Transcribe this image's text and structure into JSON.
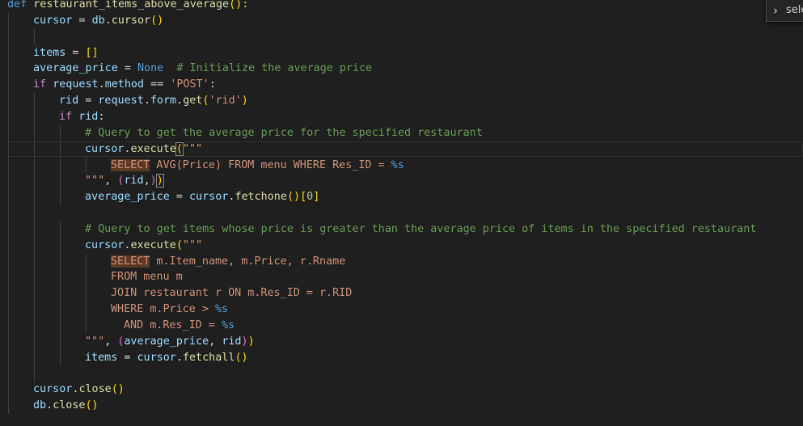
{
  "editor": {
    "lines": [
      {
        "indent": 0,
        "tokens": [
          [
            "def",
            "kw"
          ],
          [
            " ",
            ""
          ],
          [
            "restaurant_items_above_average",
            "fn"
          ],
          [
            "():",
            "p1"
          ]
        ]
      },
      {
        "indent": 2,
        "tokens": [
          [
            "cursor",
            "var"
          ],
          [
            " = ",
            "op"
          ],
          [
            "db",
            "var"
          ],
          [
            ".",
            ""
          ],
          [
            "cursor",
            "fn"
          ],
          [
            "()",
            "p1"
          ]
        ]
      },
      {
        "indent": 0,
        "tokens": []
      },
      {
        "indent": 2,
        "tokens": [
          [
            "items",
            "var"
          ],
          [
            " = ",
            "op"
          ],
          [
            "[]",
            "p1"
          ]
        ]
      },
      {
        "indent": 2,
        "tokens": [
          [
            "average_price",
            "var"
          ],
          [
            " = ",
            "op"
          ],
          [
            "None",
            "kw"
          ],
          [
            "  ",
            ""
          ],
          [
            "# Initialize the average price",
            "cmt"
          ]
        ]
      },
      {
        "indent": 2,
        "tokens": [
          [
            "if",
            "ctl"
          ],
          [
            " ",
            ""
          ],
          [
            "request",
            "var"
          ],
          [
            ".",
            ""
          ],
          [
            "method",
            "var"
          ],
          [
            " == ",
            "op"
          ],
          [
            "'POST'",
            "str"
          ],
          [
            ":",
            ""
          ]
        ]
      },
      {
        "indent": 4,
        "tokens": [
          [
            "rid",
            "var"
          ],
          [
            " = ",
            "op"
          ],
          [
            "request",
            "var"
          ],
          [
            ".",
            ""
          ],
          [
            "form",
            "var"
          ],
          [
            ".",
            ""
          ],
          [
            "get",
            "fn"
          ],
          [
            "(",
            "p1"
          ],
          [
            "'rid'",
            "str"
          ],
          [
            ")",
            "p1"
          ]
        ]
      },
      {
        "indent": 4,
        "tokens": [
          [
            "if",
            "ctl"
          ],
          [
            " ",
            ""
          ],
          [
            "rid",
            "var"
          ],
          [
            ":",
            ""
          ]
        ]
      },
      {
        "indent": 6,
        "tokens": [
          [
            "# Query to get the average price for the specified restaurant",
            "cmt"
          ]
        ]
      },
      {
        "indent": 6,
        "current": true,
        "tokens": [
          [
            "cursor",
            "var"
          ],
          [
            ".",
            ""
          ],
          [
            "execute",
            "fn"
          ],
          [
            "(",
            "p1 brk"
          ],
          [
            "\"\"\"",
            "str"
          ]
        ]
      },
      {
        "indent": 8,
        "tokens": [
          [
            "SELECT",
            "str hl"
          ],
          [
            " AVG(Price) FROM menu WHERE Res_ID = ",
            "str"
          ],
          [
            "%s",
            "kw"
          ]
        ]
      },
      {
        "indent": 6,
        "tokens": [
          [
            "\"\"\"",
            "str"
          ],
          [
            ", ",
            ""
          ],
          [
            "(",
            "p2"
          ],
          [
            "rid",
            "var"
          ],
          [
            ",",
            ""
          ],
          [
            ")",
            "p2"
          ],
          [
            ")",
            "p1 brk"
          ]
        ]
      },
      {
        "indent": 6,
        "tokens": [
          [
            "average_price",
            "var"
          ],
          [
            " = ",
            "op"
          ],
          [
            "cursor",
            "var"
          ],
          [
            ".",
            ""
          ],
          [
            "fetchone",
            "fn"
          ],
          [
            "()",
            "p1"
          ],
          [
            "[",
            "p1"
          ],
          [
            "0",
            "num"
          ],
          [
            "]",
            "p1"
          ]
        ]
      },
      {
        "indent": 0,
        "tokens": []
      },
      {
        "indent": 6,
        "tokens": [
          [
            "# Query to get items whose price is greater than the average price of items in the specified restaurant",
            "cmt"
          ]
        ]
      },
      {
        "indent": 6,
        "tokens": [
          [
            "cursor",
            "var"
          ],
          [
            ".",
            ""
          ],
          [
            "execute",
            "fn"
          ],
          [
            "(",
            "p1"
          ],
          [
            "\"\"\"",
            "str"
          ]
        ]
      },
      {
        "indent": 8,
        "tokens": [
          [
            "SELECT",
            "str hl"
          ],
          [
            " m.Item_name, m.Price, r.Rname",
            "str"
          ]
        ]
      },
      {
        "indent": 8,
        "tokens": [
          [
            "FROM menu m",
            "str"
          ]
        ]
      },
      {
        "indent": 8,
        "tokens": [
          [
            "JOIN restaurant r ON m.Res_ID = r.RID",
            "str"
          ]
        ]
      },
      {
        "indent": 8,
        "tokens": [
          [
            "WHERE m.Price > ",
            "str"
          ],
          [
            "%s",
            "kw"
          ]
        ]
      },
      {
        "indent": 9,
        "tokens": [
          [
            "AND m.Res_ID = ",
            "str"
          ],
          [
            "%s",
            "kw"
          ]
        ]
      },
      {
        "indent": 6,
        "tokens": [
          [
            "\"\"\"",
            "str"
          ],
          [
            ", ",
            ""
          ],
          [
            "(",
            "p2"
          ],
          [
            "average_price",
            "var"
          ],
          [
            ", ",
            ""
          ],
          [
            "rid",
            "var"
          ],
          [
            ")",
            "p2"
          ],
          [
            ")",
            "p1"
          ]
        ]
      },
      {
        "indent": 6,
        "tokens": [
          [
            "items",
            "var"
          ],
          [
            " = ",
            "op"
          ],
          [
            "cursor",
            "var"
          ],
          [
            ".",
            ""
          ],
          [
            "fetchall",
            "fn"
          ],
          [
            "()",
            "p1"
          ]
        ]
      },
      {
        "indent": 0,
        "tokens": []
      },
      {
        "indent": 2,
        "tokens": [
          [
            "cursor",
            "var"
          ],
          [
            ".",
            ""
          ],
          [
            "close",
            "fn"
          ],
          [
            "()",
            "p1"
          ]
        ]
      },
      {
        "indent": 2,
        "tokens": [
          [
            "db",
            "var"
          ],
          [
            ".",
            ""
          ],
          [
            "close",
            "fn"
          ],
          [
            "()",
            "p1"
          ]
        ]
      }
    ]
  },
  "find_widget": {
    "toggle_icon": "chevron-right-icon",
    "input_value": "sele"
  },
  "colors": {
    "background": "#1f1f1f",
    "keyword": "#569cd6",
    "string": "#ce9178",
    "comment": "#6a9955",
    "function": "#dcdcaa",
    "variable": "#9cdcfe"
  }
}
